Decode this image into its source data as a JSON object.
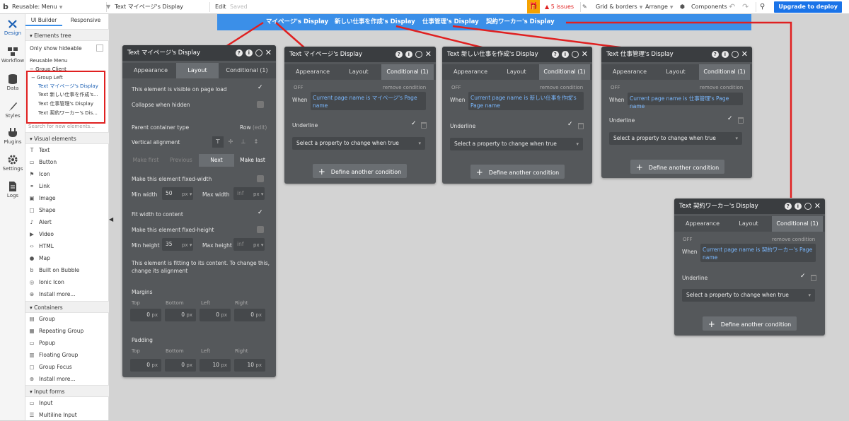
{
  "topbar": {
    "logo": "b",
    "page_selector": "Reusable: Menu",
    "element_selector": "Text マイページ's Display",
    "edit": "Edit",
    "saved": "Saved",
    "issues": "5 issues",
    "grid": "Grid & borders",
    "arrange": "Arrange",
    "components": "Components",
    "deploy": "Upgrade to deploy"
  },
  "rail": [
    {
      "label": "Design",
      "icon": "design-icon"
    },
    {
      "label": "Workflow",
      "icon": "workflow-icon"
    },
    {
      "label": "Data",
      "icon": "data-icon"
    },
    {
      "label": "Styles",
      "icon": "styles-icon"
    },
    {
      "label": "Plugins",
      "icon": "plugins-icon"
    },
    {
      "label": "Settings",
      "icon": "settings-icon"
    },
    {
      "label": "Logs",
      "icon": "logs-icon"
    }
  ],
  "sidebar": {
    "tab_ui": "UI Builder",
    "tab_responsive": "Responsive",
    "elements_tree": "Elements tree",
    "only_hideable": "Only show hideable",
    "tree": [
      "Reusable Menu",
      "Group Client",
      "Group Left",
      "Text マイページ's Display",
      "Text 新しい仕事を作成's...",
      "Text 仕事管理's Display",
      "Text 契約ワーカー's Dis..."
    ],
    "search_placeholder": "Search for new elements...",
    "visual_elements": "Visual elements",
    "visual_items": [
      "Text",
      "Button",
      "Icon",
      "Link",
      "Image",
      "Shape",
      "Alert",
      "Video",
      "HTML",
      "Map",
      "Built on Bubble",
      "Ionic Icon",
      "Install more..."
    ],
    "containers": "Containers",
    "container_items": [
      "Group",
      "Repeating Group",
      "Popup",
      "Floating Group",
      "Group Focus",
      "Install more..."
    ],
    "input_forms": "Input forms",
    "input_items": [
      "Input",
      "Multiline Input"
    ]
  },
  "strip": [
    "マイページ's Display",
    "新しい仕事を作成's Display",
    "仕事管理's Display",
    "契約ワーカー's Display"
  ],
  "layout_panel": {
    "title": "Text マイページ's Display",
    "tabs": [
      "Appearance",
      "Layout",
      "Conditional (1)"
    ],
    "visible_on_load": "This element is visible on page load",
    "collapse_hidden": "Collapse when hidden",
    "parent_type": "Parent container type",
    "parent_value": "Row",
    "parent_edit": "(edit)",
    "vertical_alignment": "Vertical alignment",
    "nav": [
      "Make first",
      "Previous",
      "Next",
      "Make last"
    ],
    "fixed_width": "Make this element fixed-width",
    "min_width_label": "Min width",
    "min_width": "50",
    "max_width_label": "Max width",
    "max_width": "inf",
    "unit": "px",
    "fit_width": "Fit width to content",
    "fixed_height": "Make this element fixed-height",
    "min_height_label": "Min height",
    "min_height": "35",
    "max_height_label": "Max height",
    "max_height": "inf",
    "fitting_note_1": "This element is fitting to its content. To change this,",
    "fitting_note_2": "change its alignment",
    "margins": "Margins",
    "padding": "Padding",
    "sides": [
      "Top",
      "Bottom",
      "Left",
      "Right"
    ],
    "margin_values": [
      "0",
      "0",
      "0",
      "0"
    ],
    "padding_values": [
      "0",
      "0",
      "10",
      "10"
    ]
  },
  "cond_panels": [
    {
      "title": "Text マイページ's Display",
      "cond": "Current page name is マイページ's Page name"
    },
    {
      "title": "Text 新しい仕事を作成's Display",
      "cond": "Current page name is 新しい仕事を作成's Page name"
    },
    {
      "title": "Text 仕事管理's Display",
      "cond": "Current page name is 仕事管理's Page name"
    },
    {
      "title": "Text 契約ワーカー's Display",
      "cond": "Current page name is 契約ワーカー's Page name"
    }
  ],
  "cond_common": {
    "tabs": [
      "Appearance",
      "Layout",
      "Conditional (1)"
    ],
    "off": "OFF",
    "remove": "remove condition",
    "when": "When",
    "underline": "Underline",
    "select_prop": "Select a property to change when true",
    "define": "Define another condition"
  },
  "colors": {
    "accent": "#3b8fe8",
    "highlight": "#e02020",
    "panel": "#55585b",
    "deploy": "#1a73e8"
  }
}
